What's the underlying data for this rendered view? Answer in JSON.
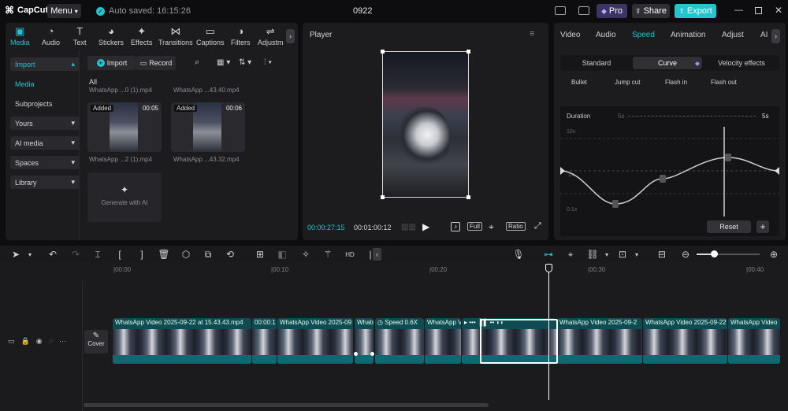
{
  "app": {
    "name": "CapCut",
    "menu_label": "Menu",
    "autosave": "Auto saved: 16:15:26",
    "project_title": "0922",
    "pro_label": "Pro",
    "share_label": "Share",
    "export_label": "Export"
  },
  "media_tabs": [
    {
      "label": "Media",
      "icon": "media-icon",
      "active": true
    },
    {
      "label": "Audio",
      "icon": "audio-icon"
    },
    {
      "label": "Text",
      "icon": "text-icon"
    },
    {
      "label": "Stickers",
      "icon": "stickers-icon"
    },
    {
      "label": "Effects",
      "icon": "effects-icon"
    },
    {
      "label": "Transitions",
      "icon": "transitions-icon"
    },
    {
      "label": "Captions",
      "icon": "captions-icon"
    },
    {
      "label": "Filters",
      "icon": "filters-icon"
    },
    {
      "label": "Adjustm",
      "icon": "adjustment-icon"
    }
  ],
  "sidebar": {
    "import": "Import",
    "media": "Media",
    "subprojects": "Subprojects",
    "items": [
      {
        "label": "Yours"
      },
      {
        "label": "AI media"
      },
      {
        "label": "Spaces"
      },
      {
        "label": "Library"
      }
    ]
  },
  "media_toolbar": {
    "import": "Import",
    "record": "Record",
    "all": "All"
  },
  "media_files": {
    "top_names": [
      "WhatsApp ...0 (1).mp4",
      "WhatsApp ...43.40.mp4"
    ],
    "thumbs": [
      {
        "badge": "Added",
        "duration": "00:05",
        "name": "WhatsApp ...2 (1).mp4"
      },
      {
        "badge": "Added",
        "duration": "00:06",
        "name": "WhatsApp ...43.32.mp4"
      }
    ],
    "generate_label": "Generate with AI"
  },
  "player": {
    "title": "Player",
    "current_time": "00:00:27:15",
    "total_time": "00:01:00:12",
    "full_label": "Full",
    "ratio_label": "Ratio"
  },
  "right_tabs": [
    {
      "label": "Video"
    },
    {
      "label": "Audio"
    },
    {
      "label": "Speed",
      "active": true
    },
    {
      "label": "Animation"
    },
    {
      "label": "Adjust"
    },
    {
      "label": "AI"
    }
  ],
  "speed": {
    "segments": [
      {
        "label": "Standard"
      },
      {
        "label": "Curve",
        "active": true
      },
      {
        "label": "Velocity effects"
      }
    ],
    "presets": [
      "Bullet",
      "Jump cut",
      "Flash in",
      "Flash out"
    ],
    "duration_label": "Duration",
    "duration_from": "5s",
    "duration_to": "5s",
    "y_top": "10x",
    "y_mid": "1x",
    "y_bottom": "0.1x",
    "reset_label": "Reset"
  },
  "timeline": {
    "ruler": [
      "|00:00",
      "|00:10",
      "|00:20",
      "|00:30",
      "|00:40"
    ],
    "cover_label": "Cover",
    "clips": [
      {
        "label": "WhatsApp Video 2025-09-22 at 15.43.43.mp4"
      },
      {
        "label": "00:00:1"
      },
      {
        "label": "WhatsApp Video 2025-09"
      },
      {
        "label": "Speed 0.6X"
      },
      {
        "label": "WhatsApp Vi"
      },
      {
        "label": "Whats"
      },
      {
        "label": "WhatsApp Video 2025-09-2"
      },
      {
        "label": "WhatsApp Video 2025-09-22"
      },
      {
        "label": "WhatsApp Video"
      }
    ]
  },
  "colors": {
    "accent": "#22c4d0",
    "panel": "#1c1c1f",
    "clip": "#0f4b52"
  }
}
